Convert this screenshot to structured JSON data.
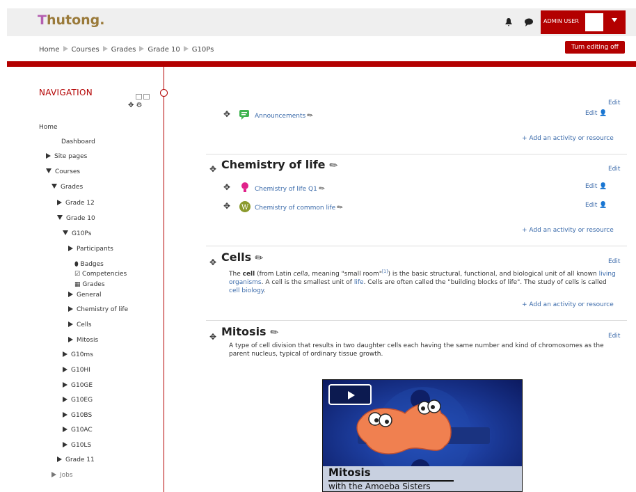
{
  "brand": {
    "logo_text": "hutong.",
    "logo_letter": "T"
  },
  "header": {
    "user_name": "ADMIN USER",
    "edit_button": "Turn editing off",
    "icons": [
      "bell-icon",
      "chat-icon",
      "caret-down-icon"
    ]
  },
  "breadcrumb": [
    "Home",
    "Courses",
    "Grades",
    "Grade 10",
    "G10Ps"
  ],
  "navigation": {
    "title": "NAVIGATION",
    "items": [
      {
        "label": "Home"
      },
      {
        "label": "Dashboard"
      },
      {
        "label": "Site pages"
      },
      {
        "label": "Courses"
      },
      {
        "label": "Grades"
      },
      {
        "label": "Grade 12"
      },
      {
        "label": "Grade 10"
      },
      {
        "label": "G10Ps"
      },
      {
        "label": "Participants"
      },
      {
        "label": "Badges"
      },
      {
        "label": "Competencies"
      },
      {
        "label": "Grades"
      },
      {
        "label": "General"
      },
      {
        "label": "Chemistry of life"
      },
      {
        "label": "Cells"
      },
      {
        "label": "Mitosis"
      },
      {
        "label": "G10ms"
      },
      {
        "label": "G10HI"
      },
      {
        "label": "G10GE"
      },
      {
        "label": "G10EG"
      },
      {
        "label": "G10BS"
      },
      {
        "label": "G10AC"
      },
      {
        "label": "G10LS"
      },
      {
        "label": "Grade 11"
      },
      {
        "label": "Jobs"
      }
    ]
  },
  "sections": {
    "general": {
      "edit": "Edit",
      "activity": "Announcements",
      "activity_edit": "Edit",
      "add": "+ Add an activity or resource"
    },
    "chemistry": {
      "title": "Chemistry of life",
      "edit": "Edit",
      "activities": [
        {
          "label": "Chemistry of life Q1",
          "edit": "Edit"
        },
        {
          "label": "Chemistry of common life",
          "edit": "Edit"
        }
      ],
      "add": "+ Add an activity or resource"
    },
    "cells": {
      "title": "Cells",
      "edit": "Edit",
      "summary_pre": "The ",
      "summary_bold": "cell",
      "summary_mid1": " (from Latin ",
      "summary_italic": "cella",
      "summary_mid2": ", meaning \"small room\"",
      "summary_sup": "[1]",
      "summary_mid3": ") is the basic structural, functional, and biological unit of all known ",
      "link1": "living organisms",
      "summary_mid4": ". A cell is the smallest unit of ",
      "link2": "life",
      "summary_mid5": ". Cells are often called the \"building blocks of life\". The study of cells is called ",
      "link3": "cell biology",
      "summary_end": ".",
      "add": "+ Add an activity or resource"
    },
    "mitosis": {
      "title": "Mitosis",
      "edit": "Edit",
      "summary": "A type of cell division that results in two daughter cells each having the same number and kind of chromosomes as the parent nucleus, typical of ordinary tissue growth.",
      "video_title": "Mitosis",
      "video_subtitle": "with the Amoeba Sisters"
    }
  }
}
